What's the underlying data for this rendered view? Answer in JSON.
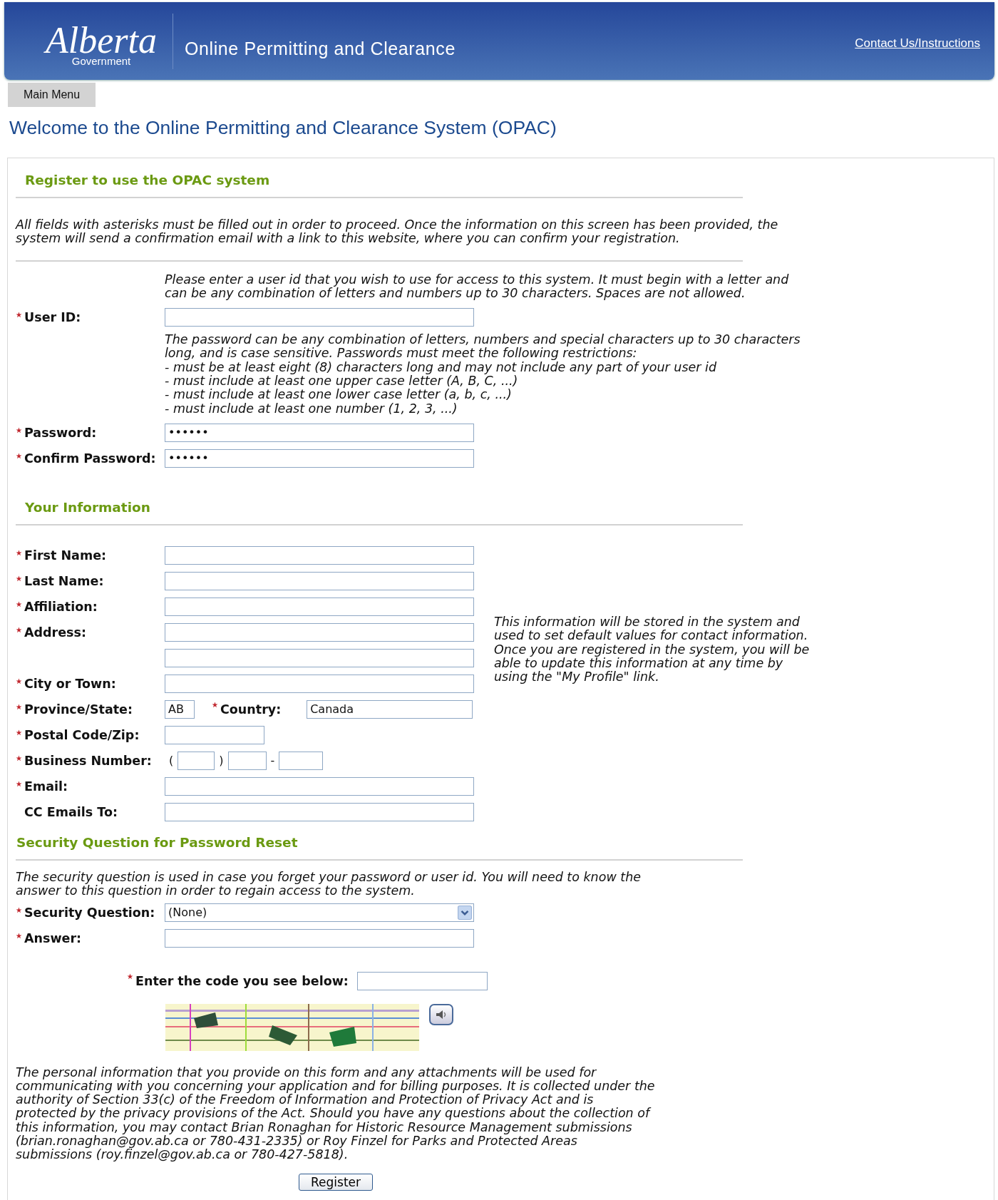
{
  "header": {
    "logo_word": "Alberta",
    "logo_sub": "Government",
    "app_title": "Online Permitting and Clearance",
    "contact_link": "Contact Us/Instructions"
  },
  "menu": [
    {
      "label": "Main Menu"
    }
  ],
  "page_title": "Welcome to the Online Permitting and Clearance System (OPAC)",
  "sections": [
    {
      "heading": "Register to use the OPAC system",
      "intro": [
        "All fields with asterisks must be filled out in order to proceed. Once the information on this screen has been provided, the",
        "system will send a confirmation email with a link to this website, where you can confirm your registration."
      ],
      "rows": [
        {
          "kind": "help",
          "lines": [
            "Please enter a user id that you wish to use for access to this system. It must begin with a letter and",
            "can be any combination of letters and numbers up to 30 characters. Spaces are not allowed."
          ]
        },
        {
          "kind": "text",
          "label": "User ID:",
          "required": true,
          "value": ""
        },
        {
          "kind": "help",
          "lines": [
            "The password can be any combination of letters, numbers and special characters up to 30 characters",
            "long, and is case sensitive. Passwords must meet the following restrictions:",
            "- must be at least eight (8) characters long and may not include any part of your user id",
            "- must include at least one upper case letter (A, B, C, ...)",
            "- must include at least one lower case letter (a, b, c, ...)",
            "- must include at least one number (1, 2, 3, ...)"
          ]
        },
        {
          "kind": "text",
          "label": "Password:",
          "required": true,
          "value": "••••••"
        },
        {
          "kind": "text",
          "label": "Confirm Password:",
          "required": true,
          "value": "••••••"
        }
      ]
    },
    {
      "heading": "Your Information",
      "note": [
        "This information will be stored in the system and",
        "used to set default values for contact information.",
        "Once you are registered in the system, you will be",
        "able to update this information at any time by",
        "using the \"My Profile\" link."
      ],
      "rows": [
        {
          "kind": "text",
          "label": "First Name:",
          "required": true,
          "value": ""
        },
        {
          "kind": "text",
          "label": "Last Name:",
          "required": true,
          "value": ""
        },
        {
          "kind": "text",
          "label": "Affiliation:",
          "required": true,
          "value": ""
        },
        {
          "kind": "text",
          "label": "Address:",
          "required": true,
          "value": ""
        },
        {
          "kind": "text",
          "required": false,
          "value": ""
        },
        {
          "kind": "text",
          "label": "City or Town:",
          "required": true,
          "value": ""
        },
        {
          "kind": "pair",
          "label": "Province/State:",
          "required": true,
          "value": "AB",
          "label2": "Country:",
          "required2": true,
          "value2": "Canada"
        },
        {
          "kind": "short",
          "label": "Postal Code/Zip:",
          "required": true,
          "value": ""
        },
        {
          "kind": "phone",
          "label": "Business Number:",
          "required": true,
          "parts": [
            "(",
            ")",
            "-"
          ]
        },
        {
          "kind": "text",
          "label": "Email:",
          "required": true,
          "value": ""
        },
        {
          "kind": "text",
          "label": "CC Emails To:",
          "required": false,
          "value": ""
        }
      ]
    },
    {
      "heading": "Security Question for Password Reset",
      "intro": [
        "The security question is used in case you forget your password or user id. You will need to know the",
        "answer to this question in order to regain access to the system."
      ],
      "rows": [
        {
          "kind": "select",
          "label": "Security Question:",
          "required": true,
          "value": "(None)"
        },
        {
          "kind": "text",
          "label": "Answer:",
          "required": true,
          "value": ""
        }
      ]
    }
  ],
  "captcha": {
    "label": "Enter the code you see below:",
    "required": true
  },
  "privacy": [
    "The personal information that you provide on this form and any attachments will be used for",
    "communicating with you concerning your application and for billing purposes. It is collected under the",
    "authority of Section 33(c) of the Freedom of Information and Protection of Privacy Act and is",
    "protected by the privacy provisions of the Act. Should you have any questions about the collection of",
    "this information, you may contact Brian Ronaghan for Historic Resource Management submissions",
    "(brian.ronaghan@gov.ab.ca or 780-431-2335) or Roy Finzel for Parks and Protected Areas",
    "submissions (roy.finzel@gov.ab.ca or 780-427-5818)."
  ],
  "submit": "Register"
}
